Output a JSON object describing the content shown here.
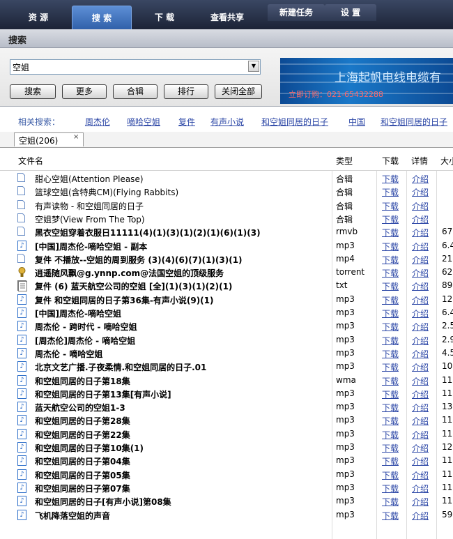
{
  "nav": {
    "tabs": [
      {
        "label": "资 源",
        "active": false
      },
      {
        "label": "搜 索",
        "active": true
      },
      {
        "label": "下 载",
        "active": false
      },
      {
        "label": "查看共享",
        "active": false
      },
      {
        "label": "新建任务",
        "active": false
      },
      {
        "label": "设 置",
        "active": false
      }
    ]
  },
  "panel": {
    "title": "搜索"
  },
  "search": {
    "value": "空姐",
    "buttons": [
      "搜索",
      "更多",
      "合辑",
      "排行",
      "关闭全部"
    ]
  },
  "ad": {
    "title": "上海起帆电线电缆有",
    "phone": "立即订购：021-65432288"
  },
  "related": {
    "label": "相关搜索：",
    "items": [
      "周杰伦",
      "嘀哈空姐",
      "复件",
      "有声小说",
      "和空姐同居的日子",
      "中国",
      "和空姐同居的日子"
    ]
  },
  "results_tab": {
    "label": "空姐(206)",
    "close": "×"
  },
  "table": {
    "headers": {
      "name": "文件名",
      "type": "类型",
      "download": "下载",
      "detail": "详情",
      "size": "大小"
    },
    "link_download": "下载",
    "link_detail": "介绍",
    "rows": [
      {
        "name": "甜心空姐(Attention Please)",
        "type": "合辑",
        "size": "",
        "icon": "doc",
        "bold": false
      },
      {
        "name": "篮球空姐(含特典CM)(Flying Rabbits)",
        "type": "合辑",
        "size": "",
        "icon": "doc",
        "bold": false
      },
      {
        "name": "有声读物 - 和空姐同居的日子",
        "type": "合辑",
        "size": "",
        "icon": "doc",
        "bold": false
      },
      {
        "name": "空姐梦(View From The Top)",
        "type": "合辑",
        "size": "",
        "icon": "doc",
        "bold": false
      },
      {
        "name": "黑衣空姐穿着衣服日11111(4)(1)(3)(1)(2)(1)(6)(1)(3)",
        "type": "rmvb",
        "size": "67",
        "icon": "doc",
        "bold": true
      },
      {
        "name": "[中国]周杰伦-嘀哈空姐 - 副本",
        "type": "mp3",
        "size": "6.4",
        "icon": "mp3",
        "bold": true
      },
      {
        "name": "复件 不播放--空姐的周到服务 (3)(4)(6)(7)(1)(3)(1)",
        "type": "mp4",
        "size": "21",
        "icon": "doc",
        "bold": true
      },
      {
        "name": "逍遥随风飘@g.ynnp.com@法国空姐的顶级服务",
        "type": "torrent",
        "size": "62",
        "icon": "torrent",
        "bold": true
      },
      {
        "name": "复件 (6) 蓝天航空公司的空姐 [全](1)(3)(1)(2)(1)",
        "type": "txt",
        "size": "89",
        "icon": "txt",
        "bold": true
      },
      {
        "name": "复件 和空姐同居的日子第36集-有声小说(9)(1)",
        "type": "mp3",
        "size": "12",
        "icon": "mp3",
        "bold": true
      },
      {
        "name": "[中国]周杰伦-嘀哈空姐",
        "type": "mp3",
        "size": "6.4",
        "icon": "mp3",
        "bold": true
      },
      {
        "name": "周杰伦 - 跨时代 - 嘀哈空姐",
        "type": "mp3",
        "size": "2.5",
        "icon": "mp3",
        "bold": true
      },
      {
        "name": "[周杰伦]周杰伦 - 嘀哈空姐",
        "type": "mp3",
        "size": "2.9",
        "icon": "mp3",
        "bold": true
      },
      {
        "name": "周杰伦 - 嘀哈空姐",
        "type": "mp3",
        "size": "4.5",
        "icon": "mp3",
        "bold": true
      },
      {
        "name": "北京文艺广播.子夜柔情.和空姐同居的日子.01",
        "type": "mp3",
        "size": "10",
        "icon": "mp3",
        "bold": true
      },
      {
        "name": "和空姐同居的日子第18集",
        "type": "wma",
        "size": "11",
        "icon": "mp3",
        "bold": true
      },
      {
        "name": "和空姐同居的日子第13集[有声小说]",
        "type": "mp3",
        "size": "11",
        "icon": "mp3",
        "bold": true
      },
      {
        "name": "蓝天航空公司的空姐1-3",
        "type": "mp3",
        "size": "13",
        "icon": "mp3",
        "bold": true
      },
      {
        "name": "和空姐同居的日子第28集",
        "type": "mp3",
        "size": "11",
        "icon": "mp3",
        "bold": true
      },
      {
        "name": "和空姐同居的日子第22集",
        "type": "mp3",
        "size": "11",
        "icon": "mp3",
        "bold": true
      },
      {
        "name": "和空姐同居的日子第10集(1)",
        "type": "mp3",
        "size": "12",
        "icon": "mp3",
        "bold": true
      },
      {
        "name": "和空姐同居的日子第04集",
        "type": "mp3",
        "size": "11",
        "icon": "mp3",
        "bold": true
      },
      {
        "name": "和空姐同居的日子第05集",
        "type": "mp3",
        "size": "11",
        "icon": "mp3",
        "bold": true
      },
      {
        "name": "和空姐同居的日子第07集",
        "type": "mp3",
        "size": "11",
        "icon": "mp3",
        "bold": true
      },
      {
        "name": "和空姐同居的日子[有声小说]第08集",
        "type": "mp3",
        "size": "11",
        "icon": "mp3",
        "bold": true
      },
      {
        "name": "飞机降落空姐的声音",
        "type": "mp3",
        "size": "59",
        "icon": "mp3",
        "bold": true
      }
    ]
  }
}
